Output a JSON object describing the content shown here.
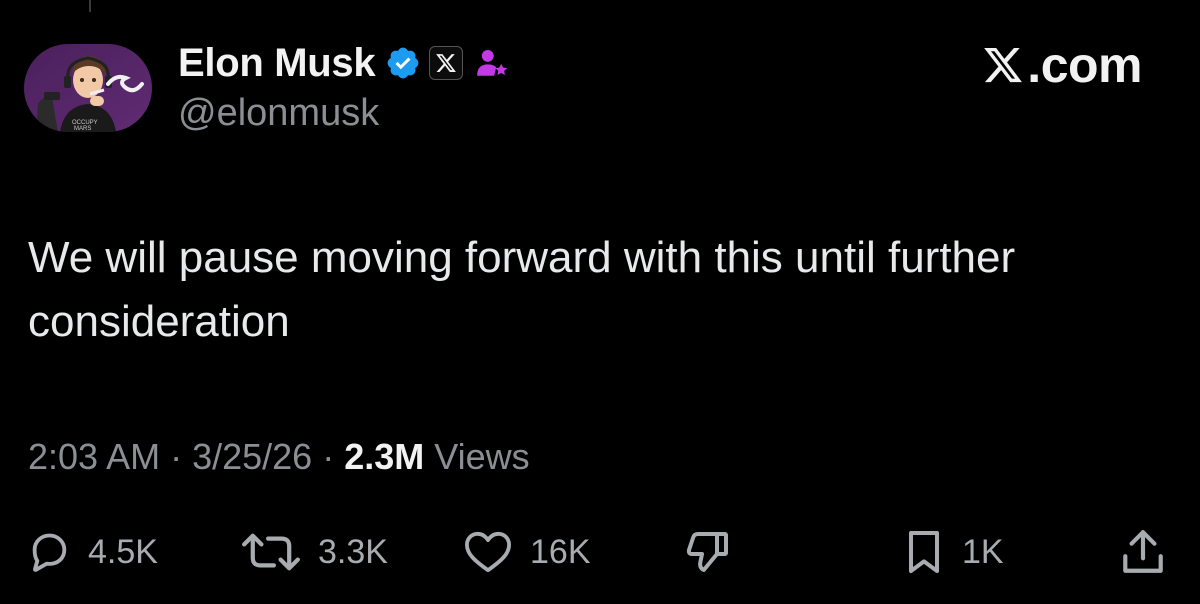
{
  "author": {
    "name": "Elon Musk",
    "handle": "@elonmusk",
    "avatar_icon": "avatar-image",
    "badges": [
      "verified-badge-icon",
      "x-affiliate-badge-icon",
      "person-star-icon"
    ]
  },
  "brand": {
    "logo_letter": "𝕏",
    "text": ".com"
  },
  "tweet": {
    "text": "We will pause moving forward with this until further consideration",
    "time": "2:03 AM",
    "date": "3/25/26",
    "views_count": "2.3M",
    "views_label": "Views",
    "separator": " · "
  },
  "actions": {
    "replies": "4.5K",
    "reposts": "3.3K",
    "likes": "16K",
    "bookmarks": "1K"
  },
  "colors": {
    "background": "#000000",
    "text": "#e7e9ea",
    "muted": "#8b8f94",
    "verified": "#1d9bf0",
    "affiliate": "#c13ae6"
  }
}
